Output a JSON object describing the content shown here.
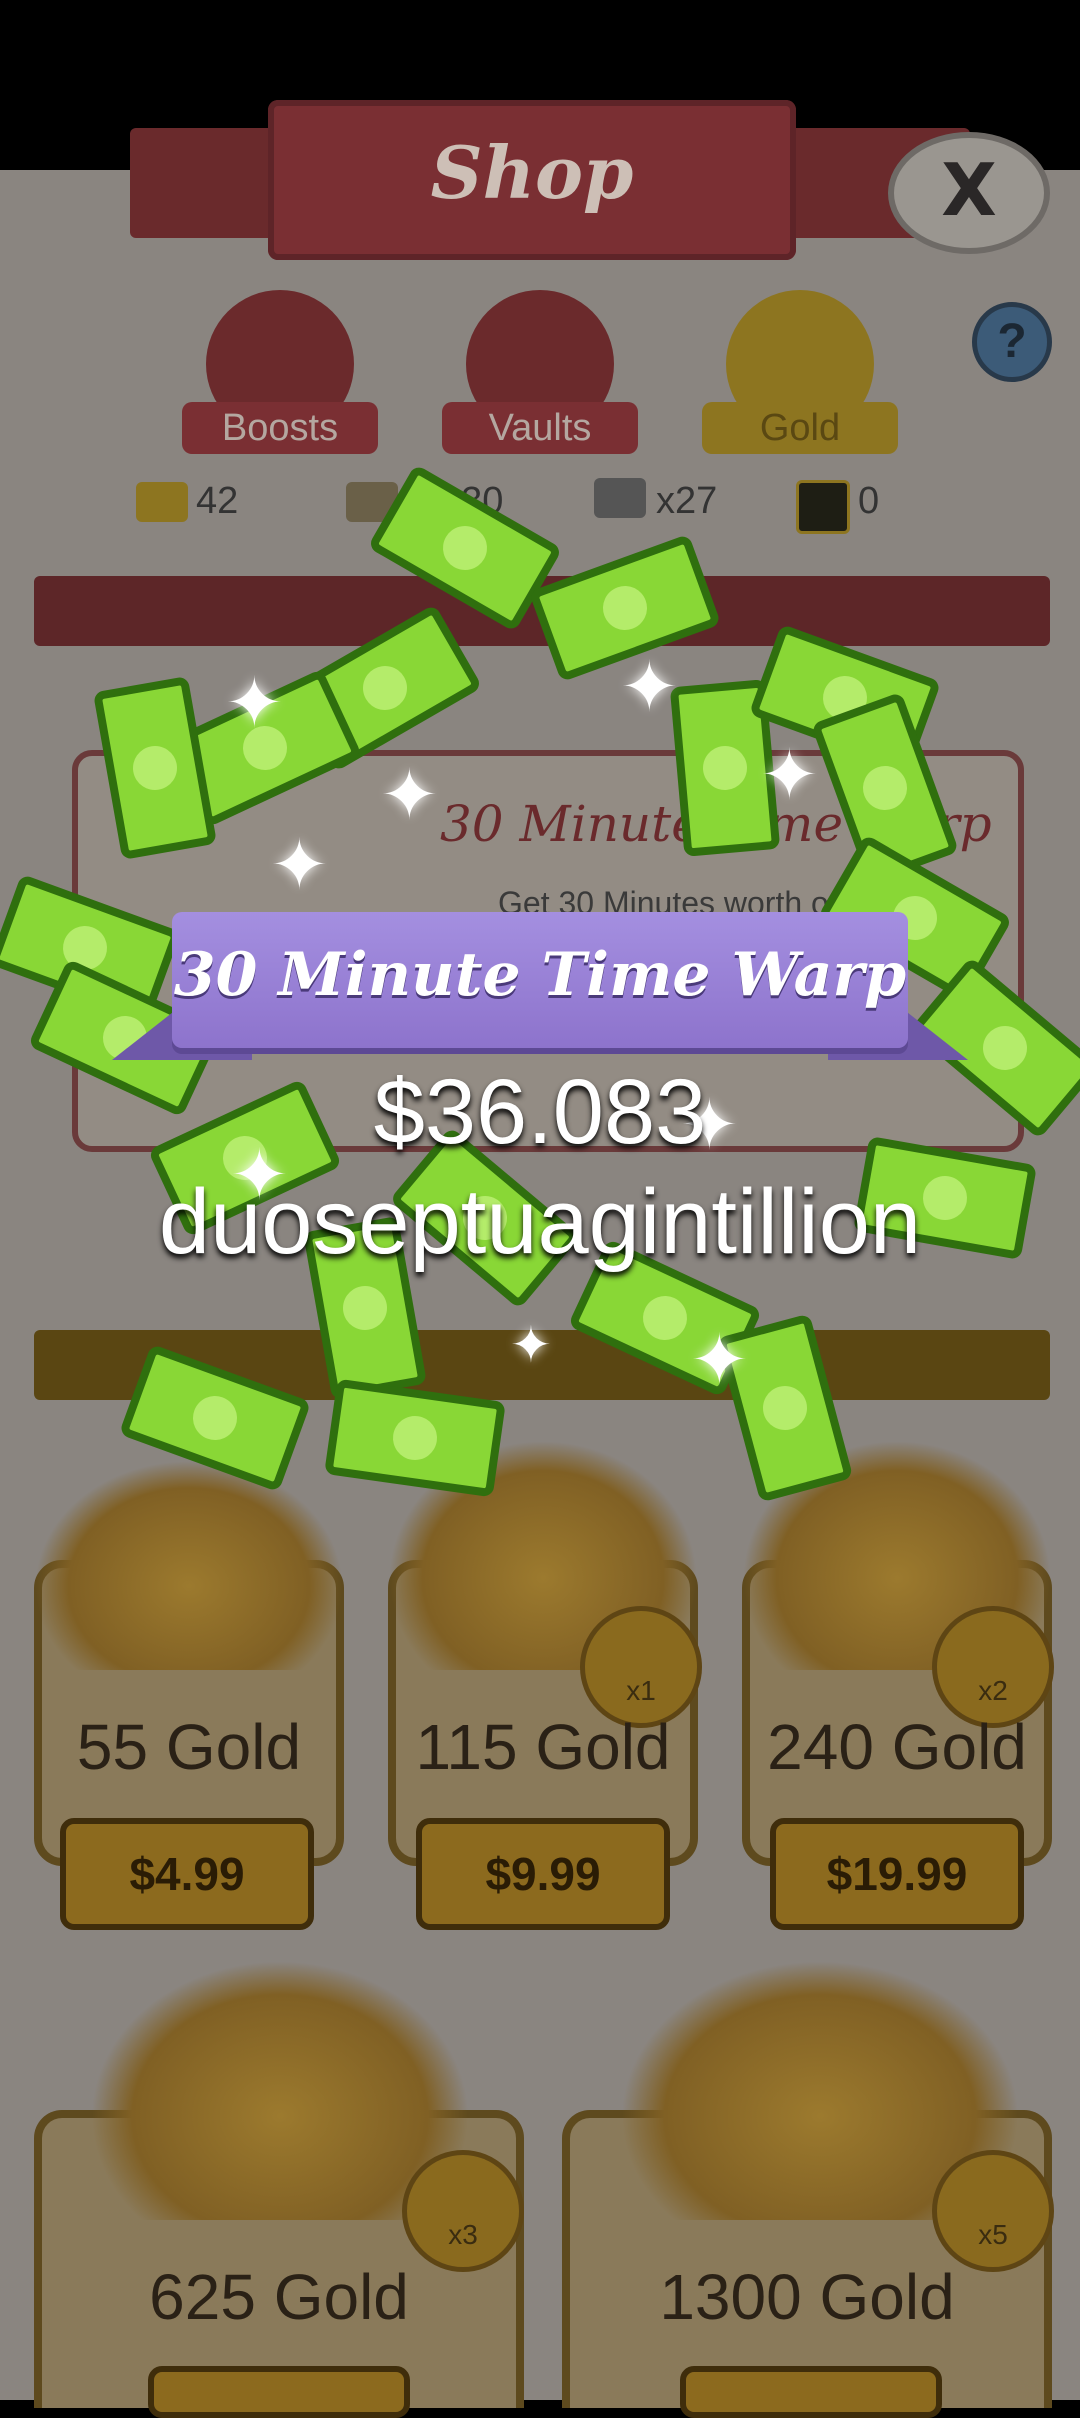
{
  "header": {
    "title": "Shop",
    "close_label": "X",
    "help_label": "?"
  },
  "tabs": [
    {
      "label": "Boosts",
      "icon": "money-bag-icon"
    },
    {
      "label": "Vaults",
      "icon": "vault-icon"
    },
    {
      "label": "Gold",
      "icon": "gold-bar-icon"
    }
  ],
  "resources": [
    {
      "icon": "gold-icon",
      "value": "42"
    },
    {
      "icon": "ticket-icon",
      "value": "230"
    },
    {
      "icon": "cash-stack-icon",
      "value": "x27"
    },
    {
      "icon": "mega-icon",
      "value": "0"
    }
  ],
  "offer": {
    "title": "30 Minute Time Warp",
    "description": "Get 30 Minutes worth of"
  },
  "gold_packs": [
    {
      "label": "55 Gold",
      "price": "$4.99",
      "badge": ""
    },
    {
      "label": "115 Gold",
      "price": "$9.99",
      "badge": "x1"
    },
    {
      "label": "240 Gold",
      "price": "$19.99",
      "badge": "x2"
    },
    {
      "label": "625 Gold",
      "price": "",
      "badge": "x3"
    },
    {
      "label": "1300 Gold",
      "price": "",
      "badge": "x5"
    }
  ],
  "popup": {
    "banner": "30 Minute Time Warp",
    "amount": "$36.083",
    "unit": "duoseptuagintillion"
  },
  "colors": {
    "banner": "#9a82d6",
    "cash": "#89d736",
    "dim_overlay": "#8a8580"
  }
}
